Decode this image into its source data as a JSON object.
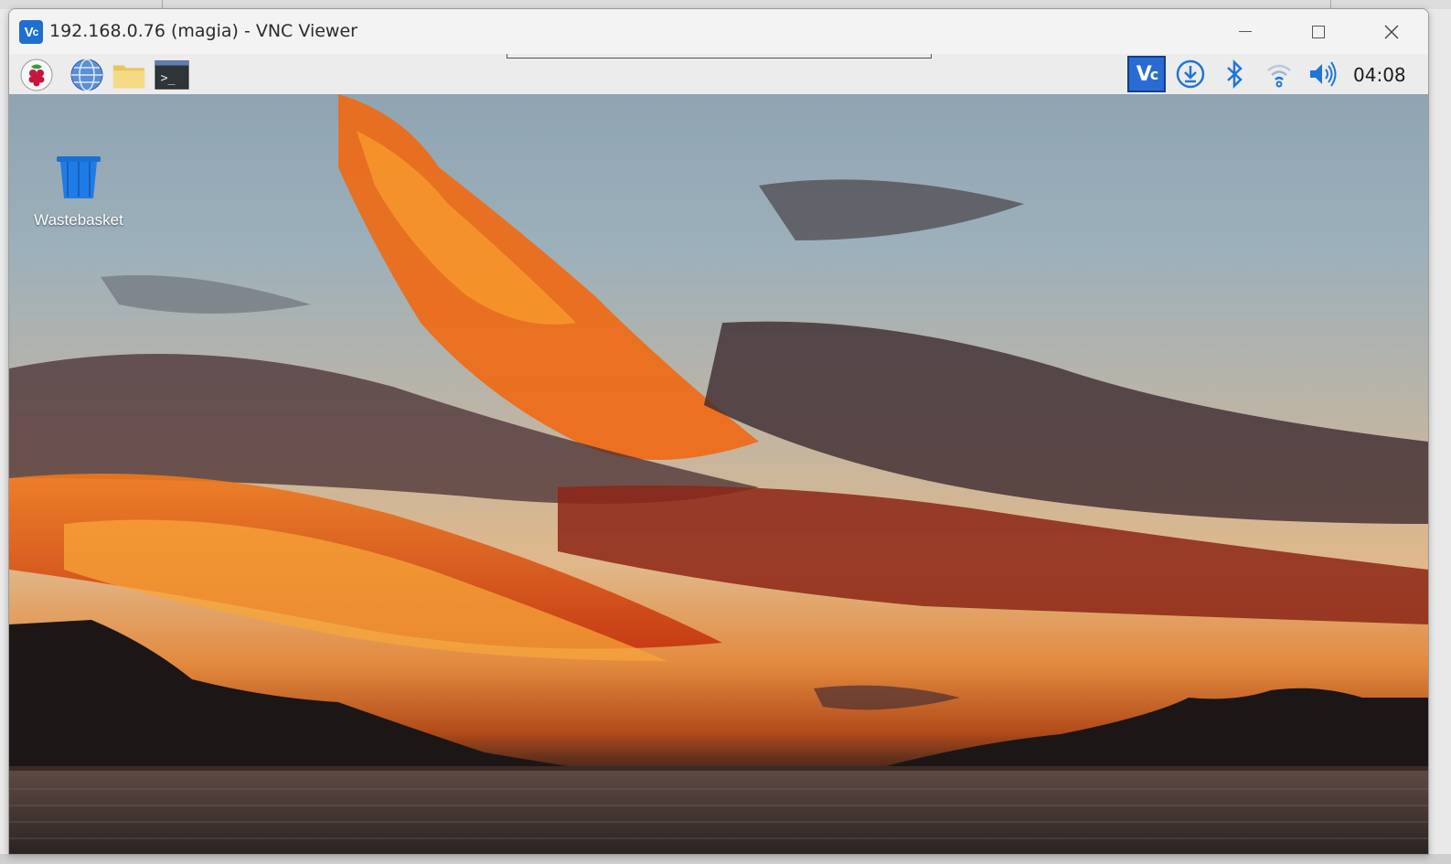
{
  "window": {
    "title": "192.168.0.76 (magia) - VNC Viewer",
    "app_icon": "vnc-logo-icon",
    "controls": [
      "minimize-icon",
      "maximize-icon",
      "close-icon"
    ]
  },
  "panel": {
    "launchers": [
      {
        "name": "raspberry-menu-icon"
      },
      {
        "name": "web-browser-icon"
      },
      {
        "name": "file-manager-icon"
      },
      {
        "name": "terminal-icon"
      }
    ],
    "tray": {
      "icons": [
        "vnc-server-icon",
        "update-download-icon",
        "bluetooth-icon",
        "wifi-icon",
        "volume-icon"
      ],
      "clock": "04:08"
    }
  },
  "desktop": {
    "icons": [
      {
        "label": "Wastebasket",
        "icon": "wastebasket-icon"
      }
    ],
    "wallpaper": "sunset-clouds-over-lake"
  },
  "colors": {
    "accent": "#2a6bd1",
    "panel_bg": "#edecec",
    "titlebar_bg": "#f3f3f3"
  }
}
